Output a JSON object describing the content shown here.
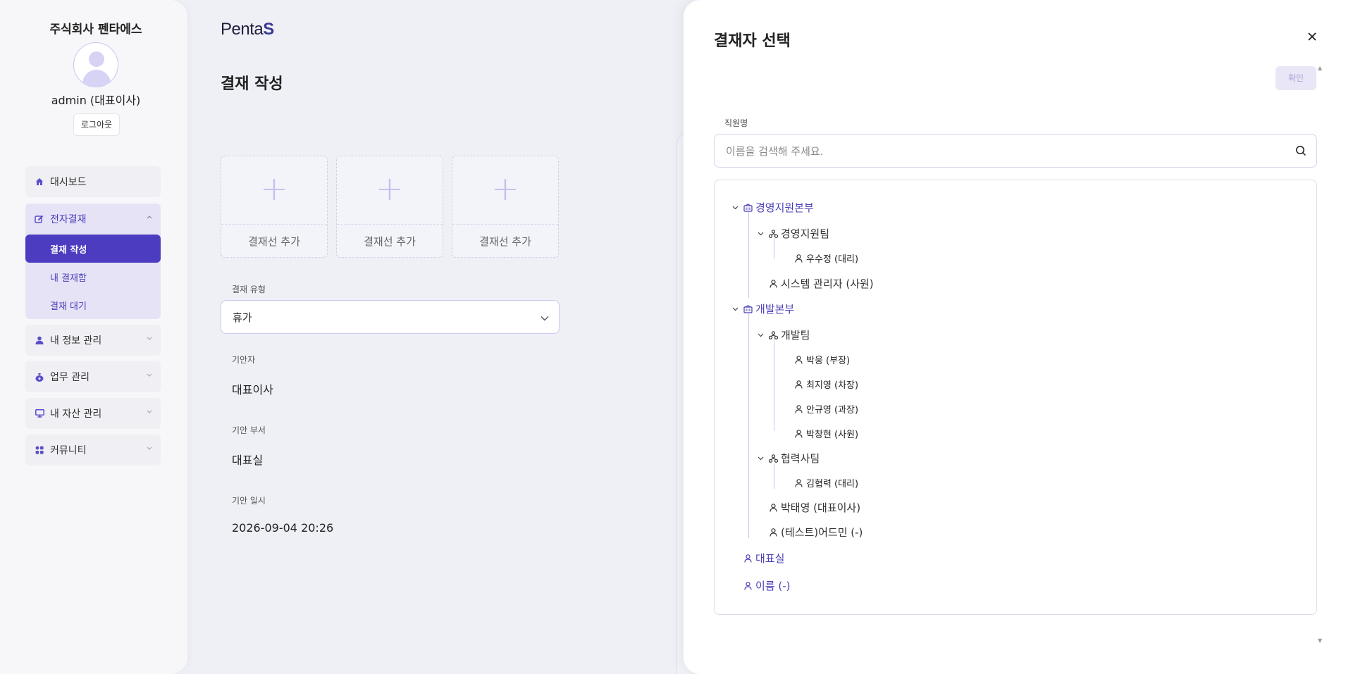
{
  "sidebar": {
    "company": "주식회사 펜타에스",
    "user": "admin (대표이사)",
    "logout_label": "로그아웃",
    "menu": {
      "dashboard": "대시보드",
      "approval": "전자결재",
      "approval_sub": [
        "결재 작성",
        "내 결재함",
        "결재 대기"
      ],
      "my_info": "내 정보 관리",
      "work": "업무 관리",
      "assets": "내 자산 관리",
      "community": "커뮤니티"
    }
  },
  "main": {
    "logo_text": "Penta",
    "logo_s": "S",
    "title": "결재 작성",
    "add_cards": [
      "결재선 추가",
      "결재선 추가",
      "결재선 추가"
    ],
    "type_label": "결재 유형",
    "type_value": "휴가",
    "drafter_label": "기안자",
    "drafter_value": "대표이사",
    "dept_label": "기안 부서",
    "dept_value": "대표실",
    "date_label": "기안 일시",
    "date_value": "2026-09-04 20:26"
  },
  "modal": {
    "title": "결재자 선택",
    "confirm_label": "확인",
    "search_label": "직원명",
    "search_placeholder": "이름을 검색해 주세요.",
    "tree": {
      "dept1": "경영지원본부",
      "team1": "경영지원팀",
      "team1_members": [
        "우수정 (대리)"
      ],
      "dept1_direct": [
        "시스템 관리자 (사원)"
      ],
      "dept2": "개발본부",
      "team2": "개발팀",
      "team2_members": [
        "박웅 (부장)",
        "최지영 (차장)",
        "안규영 (과장)",
        "박창현 (사원)"
      ],
      "team3": "협력사팀",
      "team3_members": [
        "김협력 (대리)"
      ],
      "dept2_direct": [
        "박태영 (대표이사)",
        "(테스트)어드민 (-)"
      ],
      "root1": "대표실",
      "root2": "이름 (-)"
    }
  },
  "colors": {
    "accent": "#4c3cc0",
    "accent_light": "#e6e3f7",
    "dept_text": "#4a3fb8"
  }
}
